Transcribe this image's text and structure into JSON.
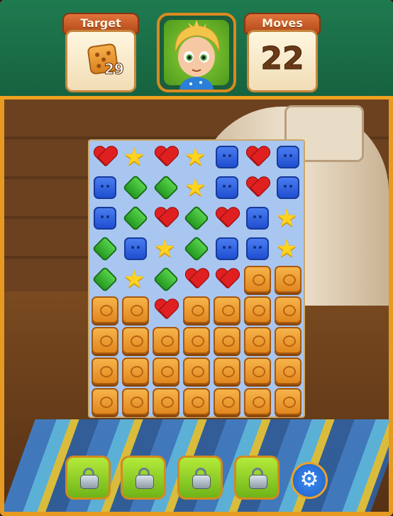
{
  "hud": {
    "target_label": "Target",
    "target_count": "29",
    "moves_label": "Moves",
    "moves_value": "22"
  },
  "board": {
    "rows": [
      [
        "heart",
        "star",
        "heart",
        "star",
        "square",
        "heart",
        "square"
      ],
      [
        "square",
        "diamond",
        "diamond",
        "star",
        "square",
        "heart",
        "square"
      ],
      [
        "square",
        "diamond",
        "heart",
        "diamond",
        "heart",
        "square",
        "star"
      ],
      [
        "diamond",
        "square",
        "star",
        "diamond",
        "square",
        "square",
        "star"
      ],
      [
        "diamond",
        "star",
        "diamond",
        "heart",
        "heart",
        "crate",
        "crate"
      ],
      [
        "crate",
        "crate",
        "heart",
        "crate",
        "crate",
        "crate",
        "crate"
      ],
      [
        "crate",
        "crate",
        "crate",
        "crate",
        "crate",
        "crate",
        "crate"
      ],
      [
        "crate",
        "crate",
        "crate",
        "crate",
        "crate",
        "crate",
        "crate"
      ],
      [
        "crate",
        "crate",
        "crate",
        "crate",
        "crate",
        "crate",
        "crate"
      ]
    ]
  },
  "boosters": [
    {
      "icon": "lock-icon",
      "locked": true
    },
    {
      "icon": "lock-icon",
      "locked": true
    },
    {
      "icon": "lock-icon",
      "locked": true
    },
    {
      "icon": "lock-icon",
      "locked": true
    }
  ],
  "settings_icon": "gear-icon"
}
